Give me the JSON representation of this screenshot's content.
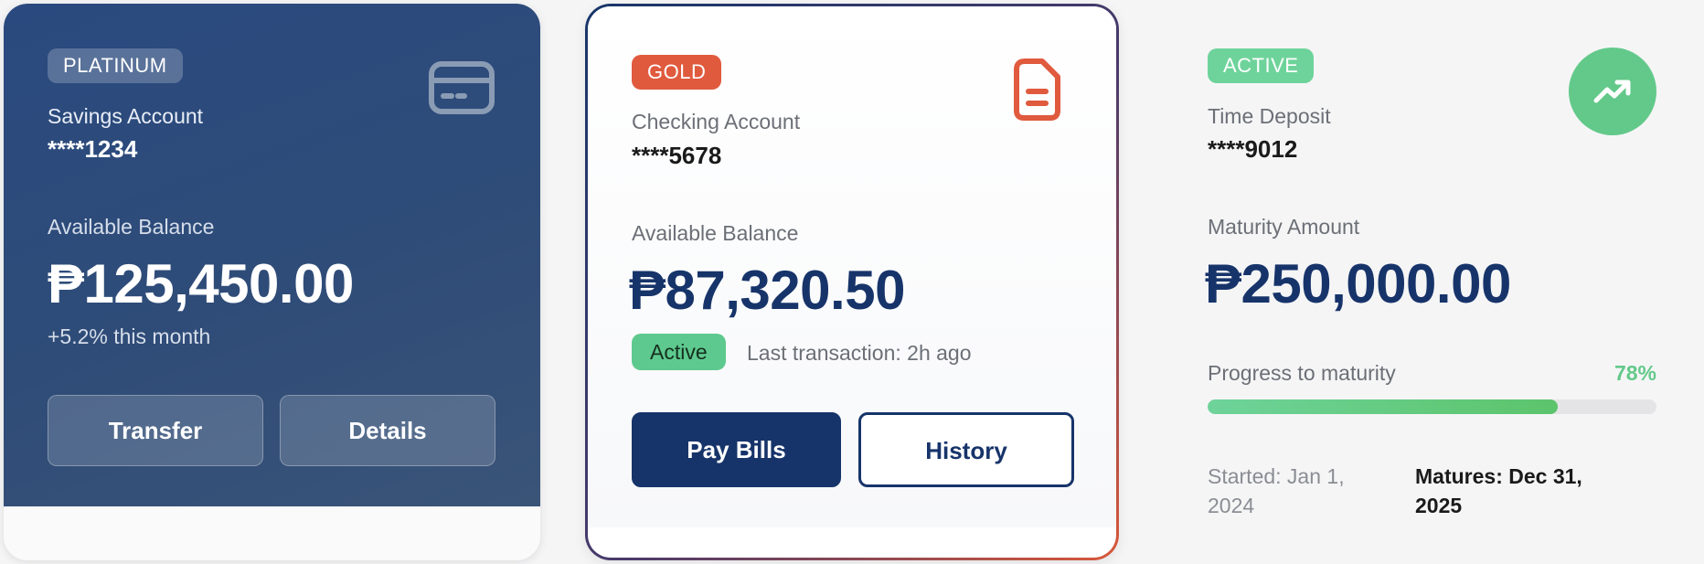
{
  "cards": {
    "platinum": {
      "tier": "PLATINUM",
      "account_type": "Savings Account",
      "account_number": "****1234",
      "balance_label": "Available Balance",
      "balance": "₱125,450.00",
      "change_text": "+5.2% this month",
      "transfer_label": "Transfer",
      "details_label": "Details",
      "icon": "credit-card-icon"
    },
    "gold": {
      "tier": "GOLD",
      "account_type": "Checking Account",
      "account_number": "****5678",
      "balance_label": "Available Balance",
      "balance": "₱87,320.50",
      "status": "Active",
      "last_transaction": "Last transaction: 2h ago",
      "pay_bills_label": "Pay Bills",
      "history_label": "History",
      "icon": "document-icon"
    },
    "time_deposit": {
      "status": "ACTIVE",
      "account_type": "Time Deposit",
      "account_number": "****9012",
      "amount_label": "Maturity Amount",
      "amount": "₱250,000.00",
      "progress_label": "Progress to maturity",
      "progress_percent": "78%",
      "progress_value": 0.78,
      "started": "Started: Jan 1, 2024",
      "matures": "Matures: Dec 31, 2025",
      "icon": "trending-up-icon"
    }
  },
  "colors": {
    "navy": "#17346a",
    "platinum_panel": "#2a4a7f",
    "gold_badge": "#e05a3e",
    "green": "#63c98a",
    "active_pill": "#5ec98e"
  }
}
